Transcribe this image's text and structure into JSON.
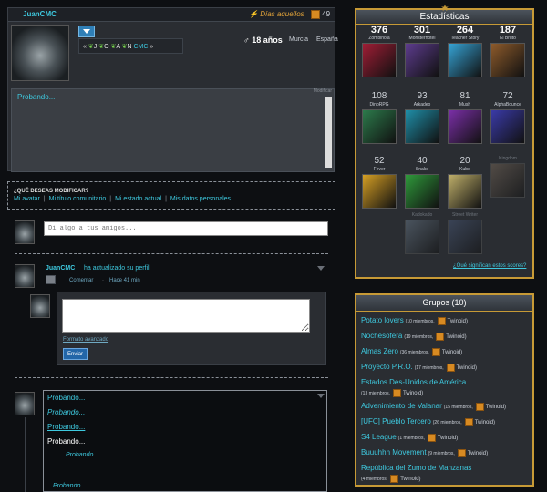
{
  "profile": {
    "username": "JuanCMC",
    "title_badge": "Días aquellos",
    "points": "49",
    "age": "18 años",
    "city": "Murcia",
    "country": "España",
    "status_chips": [
      "«",
      "J",
      "O",
      "A",
      "N",
      "CMC",
      "»"
    ],
    "status_text": "Probando...",
    "modify_label": "Modificar"
  },
  "modify_panel": {
    "title": "¿QUÉ DESEAS MODIFICAR?",
    "links": [
      "Mi avatar",
      "Mi título comunitario",
      "Mi estado actual",
      "Mis datos personales"
    ]
  },
  "composer": {
    "placeholder": "Di algo a tus amigos..."
  },
  "activity": {
    "user": "JuanCMC",
    "text": "ha actualizado su perfil.",
    "comment_link": "Comentar",
    "time": "Hace 41 min",
    "reply": {
      "format_link": "Formato avanzado",
      "send_label": "Enviar"
    }
  },
  "thread": {
    "lines": [
      {
        "text": "Probando...",
        "style": "link"
      },
      {
        "text": "Probando...",
        "style": "italic-link"
      },
      {
        "text": "Probando...",
        "style": "link-u"
      },
      {
        "text": "Probando...",
        "style": "white"
      },
      {
        "text": "Probando...",
        "style": "small-italic-link"
      },
      {
        "text": "Probando...",
        "style": "small-italic-link"
      }
    ]
  },
  "stats": {
    "title": "Estadísticas",
    "games": [
      {
        "count": "376",
        "name": "Zombinoia",
        "color": "#a01d35",
        "dim": false
      },
      {
        "count": "301",
        "name": "Monsterhotel",
        "color": "#5d3c8e",
        "dim": false
      },
      {
        "count": "264",
        "name": "Teacher Story",
        "color": "#36a4d6",
        "dim": false
      },
      {
        "count": "187",
        "name": "El Bruto",
        "color": "#8d5a2b",
        "dim": false
      },
      {
        "count": "108",
        "name": "DinoRPG",
        "color": "#2c7a4b",
        "dim": false
      },
      {
        "count": "93",
        "name": "Arkadeo",
        "color": "#1f8ea8",
        "dim": false
      },
      {
        "count": "81",
        "name": "Mush",
        "color": "#7b2fa8",
        "dim": false
      },
      {
        "count": "72",
        "name": "AlphaBounce",
        "color": "#3a3aa8",
        "dim": false
      },
      {
        "count": "52",
        "name": "Fever",
        "color": "#d6a024",
        "dim": false
      },
      {
        "count": "40",
        "name": "Snake",
        "color": "#2f9a3b",
        "dim": false
      },
      {
        "count": "20",
        "name": "Kube",
        "color": "#c0b06a",
        "dim": false
      },
      {
        "count": "",
        "name": "Kingdom",
        "color": "#7a6a5a",
        "dim": true
      },
      {
        "count": "",
        "name": "Kadokado",
        "color": "#6a7a8a",
        "dim": true
      },
      {
        "count": "",
        "name": "Street Writer",
        "color": "#4a5a7a",
        "dim": true
      }
    ],
    "link": "¿Qué significan estos scores?"
  },
  "groups": {
    "title": "Grupos (10)",
    "items": [
      {
        "name": "Potato lovers",
        "members": "(10 miembros,",
        "source": "Twinoid)"
      },
      {
        "name": "Nochesofera",
        "members": "(19 miembros,",
        "source": "Twinoid)"
      },
      {
        "name": "Almas Zero",
        "members": "(36 miembros,",
        "source": "Twinoid)"
      },
      {
        "name": "Proyecto P.R.O.",
        "members": "(17 miembros,",
        "source": "Twinoid)"
      },
      {
        "name": "Estados Des-Unidos de América",
        "members": "(13 miembros,",
        "source": "Twinoid)"
      },
      {
        "name": "Advenimiento de Valanar",
        "members": "(15 miembros,",
        "source": "Twinoid)"
      },
      {
        "name": "[UFC] Pueblo Tercero",
        "members": "(26 miembros,",
        "source": "Twinoid)"
      },
      {
        "name": "S4 League",
        "members": "(1 miembros,",
        "source": "Twinoid)"
      },
      {
        "name": "Buuuhhh Movement",
        "members": "(9 miembros,",
        "source": "Twinoid)"
      },
      {
        "name": "República del Zumo de Manzanas",
        "members": "(4 miembros,",
        "source": "Twinoid)"
      }
    ]
  }
}
